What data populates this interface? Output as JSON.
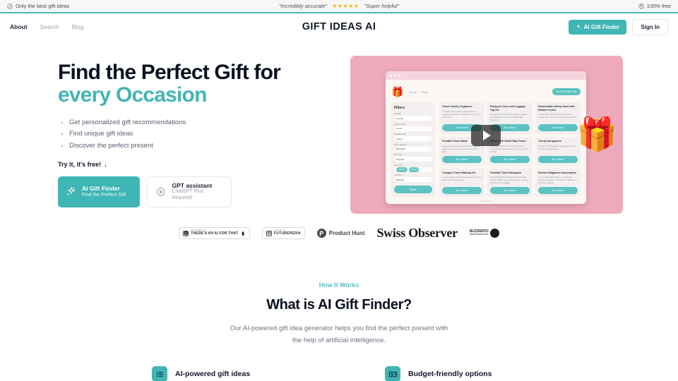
{
  "announcement": {
    "left_text": "Only the best gift ideas",
    "left_icon": "check-circle-icon",
    "quote_left": "\"Incredibly accurate\"",
    "stars": "★★★★★",
    "quote_right": "\"Super helpful\"",
    "right_text": "100% free",
    "right_icon": "badge-icon",
    "accent_color": "#49b8b8"
  },
  "header": {
    "nav": [
      {
        "label": "About",
        "active": true
      },
      {
        "label": "Search",
        "active": false
      },
      {
        "label": "Blog",
        "active": false
      }
    ],
    "brand": "GIFT IDEAS AI",
    "cta_label": "AI Gift Finder",
    "cta_icon": "sparkles-icon",
    "signin_label": "Sign In"
  },
  "hero": {
    "title_line1": "Find the Perfect Gift for",
    "title_line2": "every Occasion",
    "bullets": [
      "Get personalized gift recommendations",
      "Find unique gift ideas",
      "Discover the perfect present"
    ],
    "try_text": "Try it, it's free!",
    "try_arrow": "↓",
    "cta_primary": {
      "title": "AI Gift Finder",
      "subtitle": "Find the Perfect Gift",
      "icon": "sparkle-wand-icon"
    },
    "cta_secondary": {
      "title": "GPT assistant",
      "subtitle": "ChatGPT Plus Required",
      "icon": "openai-icon"
    }
  },
  "mockup": {
    "gift_icon": "gift-box-icon",
    "nav": [
      "Home",
      "Blog"
    ],
    "cta": "Find the Perfect Gift",
    "filters": {
      "title": "Filters",
      "fields": [
        {
          "label": "Gender",
          "value": "Female"
        },
        {
          "label": "Age Ranges",
          "value": "18-24"
        },
        {
          "label": "Relationship",
          "value": "Friend"
        },
        {
          "label": "Price Ranges",
          "value": "$50-$100"
        },
        {
          "label": "Gift Type",
          "value": "Physical"
        }
      ],
      "interests_label": "Interests",
      "interests": [
        "Fashion",
        "Travel"
      ],
      "occasion_label": "Occasion",
      "occasion_value": "Birthday",
      "search_label": "Search"
    },
    "cards": [
      {
        "title": "Travel Jewelry Organizer",
        "desc": "Compact and stylish jewelry case for organizing earrings, necklaces, and rings on the go.",
        "button": "Buy Product"
      },
      {
        "title": "Passport Cover and Luggage Tag Set",
        "desc": "A matching faux leather passport holder and luggage tag set for fashionable travelers.",
        "button": "Buy Product"
      },
      {
        "title": "Fashionable Infinity Scarf with Hidden Pocket",
        "desc": "A chic scarf that doubles as a secret storage for money and travel documents.",
        "button": "Buy Product"
      },
      {
        "title": "Portable Power Bank",
        "desc": "A slim, high-capacity portable charger to keep her devices powered during long trips.",
        "button": "Buy Product"
      },
      {
        "title": "Scratch Off World Map Poster",
        "desc": "A fun map that lets her scratch off the countries she has visited, inspiring future travels.",
        "button": "Buy Product"
      },
      {
        "title": "Trendy Sunglasses",
        "desc": "Stylish UV protection sunglasses perfect for sunny destinations.",
        "button": "Buy Product"
      },
      {
        "title": "Compact Travel Makeup Kit",
        "desc": "A mini makeup set with essential items for touch ups on the move.",
        "button": "Buy Product"
      },
      {
        "title": "Foldable Travel Backpack",
        "desc": "Lightweight and durable backpack that can be folded into a small pouch, saving space in her luggage.",
        "button": "Buy Product"
      },
      {
        "title": "Fashion Magazine Subscription",
        "desc": "A one-year subscription to a popular fashion magazine to keep her updated on the latest trends.",
        "button": "Buy Product"
      }
    ],
    "footer": "Data Privacy",
    "play_button": "play-icon",
    "decor_gift": "gift-box-3d-icon"
  },
  "logos": [
    {
      "name": "theres-an-ai-for-that",
      "small": "FEATURED ON",
      "bold": "THERE'S AN AI FOR THAT"
    },
    {
      "name": "futurepedia",
      "small": "Featured on",
      "bold": "FUTUREPEDIA"
    },
    {
      "name": "product-hunt",
      "mark": "P",
      "bold": "Product Hunt"
    },
    {
      "name": "swiss-observer",
      "bold": "Swiss Observer"
    },
    {
      "name": "buzzmatic",
      "b1": "BUZZMATIC",
      "b2": "SEARCH&SOCIAL"
    }
  ],
  "how_it_works": {
    "eyebrow": "How It Works",
    "heading": "What is AI Gift Finder?",
    "lede_line1": "Our AI-powered gift idea generator helps you find the perfect present with",
    "lede_line2": "the help of artificial intelligence."
  },
  "features": [
    {
      "label": "AI-powered gift ideas",
      "icon": "list-icon"
    },
    {
      "label": "Budget-friendly options",
      "icon": "ticket-icon"
    }
  ],
  "colors": {
    "teal": "#3fb5b5",
    "teal_light": "#5cc2c2",
    "pink": "#eeaabd",
    "star_yellow": "#f5b50a"
  }
}
